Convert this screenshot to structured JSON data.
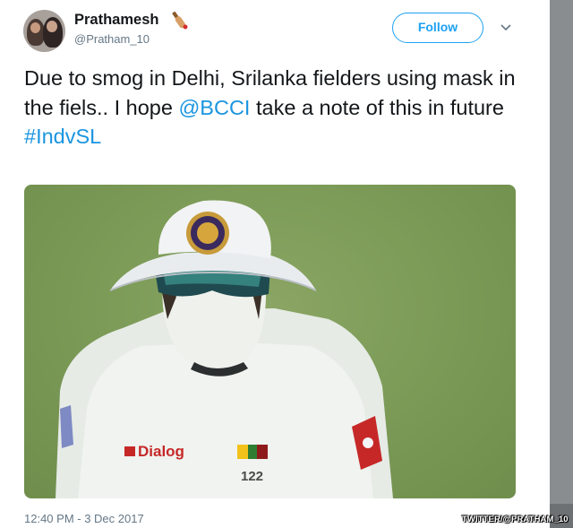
{
  "user": {
    "name": "Prathamesh",
    "handle": "@Pratham_10",
    "name_emoji_icon": "cricket-bat-icon"
  },
  "actions": {
    "follow_label": "Follow",
    "more_icon": "chevron-down-icon"
  },
  "tweet": {
    "text_part1": "Due to smog in Delhi, Srilanka fielders using mask in the fiels.. I hope ",
    "mention": "@BCCI",
    "text_part2": " take a note of this in future",
    "hashtag": "#IndvSL"
  },
  "media": {
    "sponsor_text": "Dialog",
    "shirt_number": "122"
  },
  "footer": {
    "timestamp": "12:40 PM - 3 Dec 2017",
    "credit": "TWITTER/@PRATHAM_10"
  },
  "colors": {
    "link": "#1b95e0",
    "follow_border": "#1da1f2",
    "secondary_text": "#657786",
    "pitch_green": "#7d9c58"
  }
}
